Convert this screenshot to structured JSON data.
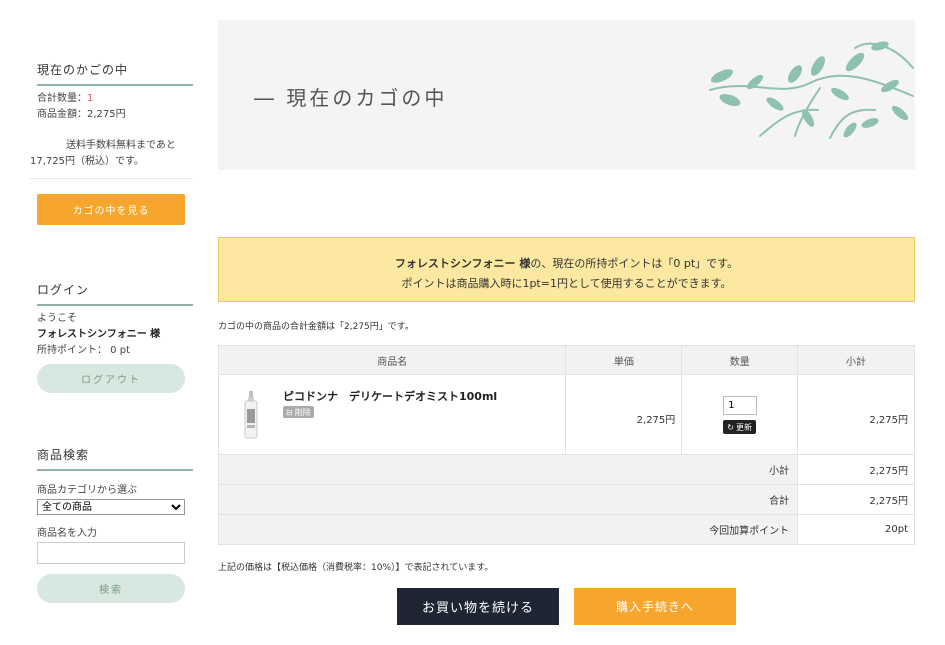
{
  "sidebar": {
    "cart": {
      "heading": "現在のかごの中",
      "quantity_label": "合計数量：",
      "quantity_value": "1",
      "amount_line": "商品金額：2,275円",
      "shipping_line1": "送料手数料無料まであと",
      "shipping_line2": "17,725円（税込）です。",
      "view_button": "カゴの中を見る"
    },
    "login": {
      "heading": "ログイン",
      "welcome": "ようこそ",
      "user_name": "フォレストシンフォニー 様",
      "points": "所持ポイント： 0 pt",
      "logout_button": "ログアウト"
    },
    "search": {
      "heading": "商品検索",
      "category_label": "商品カテゴリから選ぶ",
      "category_selected": "全ての商品",
      "name_label": "商品名を入力",
      "name_value": "",
      "search_button": "検索"
    }
  },
  "hero": {
    "title": "― 現在のカゴの中"
  },
  "points_notice": {
    "user": "フォレストシンフォニー 様",
    "line1_rest": "の、現在の所持ポイントは「0 pt」です。",
    "line2": "ポイントは商品購入時に1pt=1円として使用することができます。"
  },
  "cart": {
    "total_note": "カゴの中の商品の合計金額は「2,275円」です。",
    "headers": {
      "product": "商品名",
      "unit_price": "単価",
      "quantity": "数量",
      "subtotal": "小計"
    },
    "items": [
      {
        "name": "ピコドンナ　デリケートデオミスト100ml",
        "delete_label": "削除",
        "unit_price": "2,275円",
        "quantity": "1",
        "update_label": "更新",
        "subtotal": "2,275円"
      }
    ],
    "summary": {
      "subtotal_label": "小計",
      "subtotal_value": "2,275円",
      "total_label": "合計",
      "total_value": "2,275円",
      "points_label": "今回加算ポイント",
      "points_value": "20pt"
    },
    "tax_note": "上記の価格は【税込価格（消費税率：10%）】で表記されています。"
  },
  "actions": {
    "continue_button": "お買い物を続ける",
    "checkout_button": "購入手続きへ"
  },
  "colors": {
    "accent_orange": "#f6a62d",
    "sage_green": "#8fb5a2",
    "notice_yellow": "#fce8a0",
    "dark_navy": "#1f2633"
  }
}
